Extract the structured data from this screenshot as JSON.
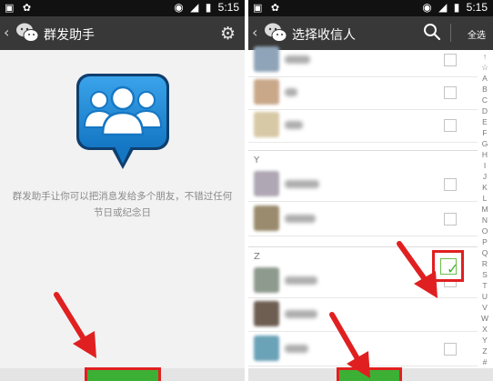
{
  "status_bar": {
    "time": "5:15"
  },
  "left_screen": {
    "title": "群发助手",
    "description_line1": "群发助手让你可以把消息发给多个朋友，不错过任何",
    "description_line2": "节日或纪念日"
  },
  "right_screen": {
    "title": "选择收信人",
    "select_all": "全选",
    "sections": {
      "y": "Y",
      "z": "Z"
    },
    "alphabet": [
      "↑",
      "☆",
      "A",
      "B",
      "C",
      "D",
      "E",
      "F",
      "G",
      "H",
      "I",
      "J",
      "K",
      "L",
      "M",
      "N",
      "O",
      "P",
      "Q",
      "R",
      "S",
      "T",
      "U",
      "V",
      "W",
      "X",
      "Y",
      "Z",
      "#"
    ],
    "contacts_checked": [
      false,
      false,
      false,
      false,
      false,
      false,
      false,
      true,
      false
    ]
  },
  "colors": {
    "title_bar": "#383838",
    "accent_green": "#3cb034",
    "highlight_red": "#e02020",
    "icon_blue": "#1a88d6"
  },
  "icons": [
    "back-chevron-icon",
    "wechat-logo-icon",
    "gear-icon",
    "group-people-icon",
    "search-icon",
    "checkmark-icon",
    "red-arrow-icon"
  ]
}
